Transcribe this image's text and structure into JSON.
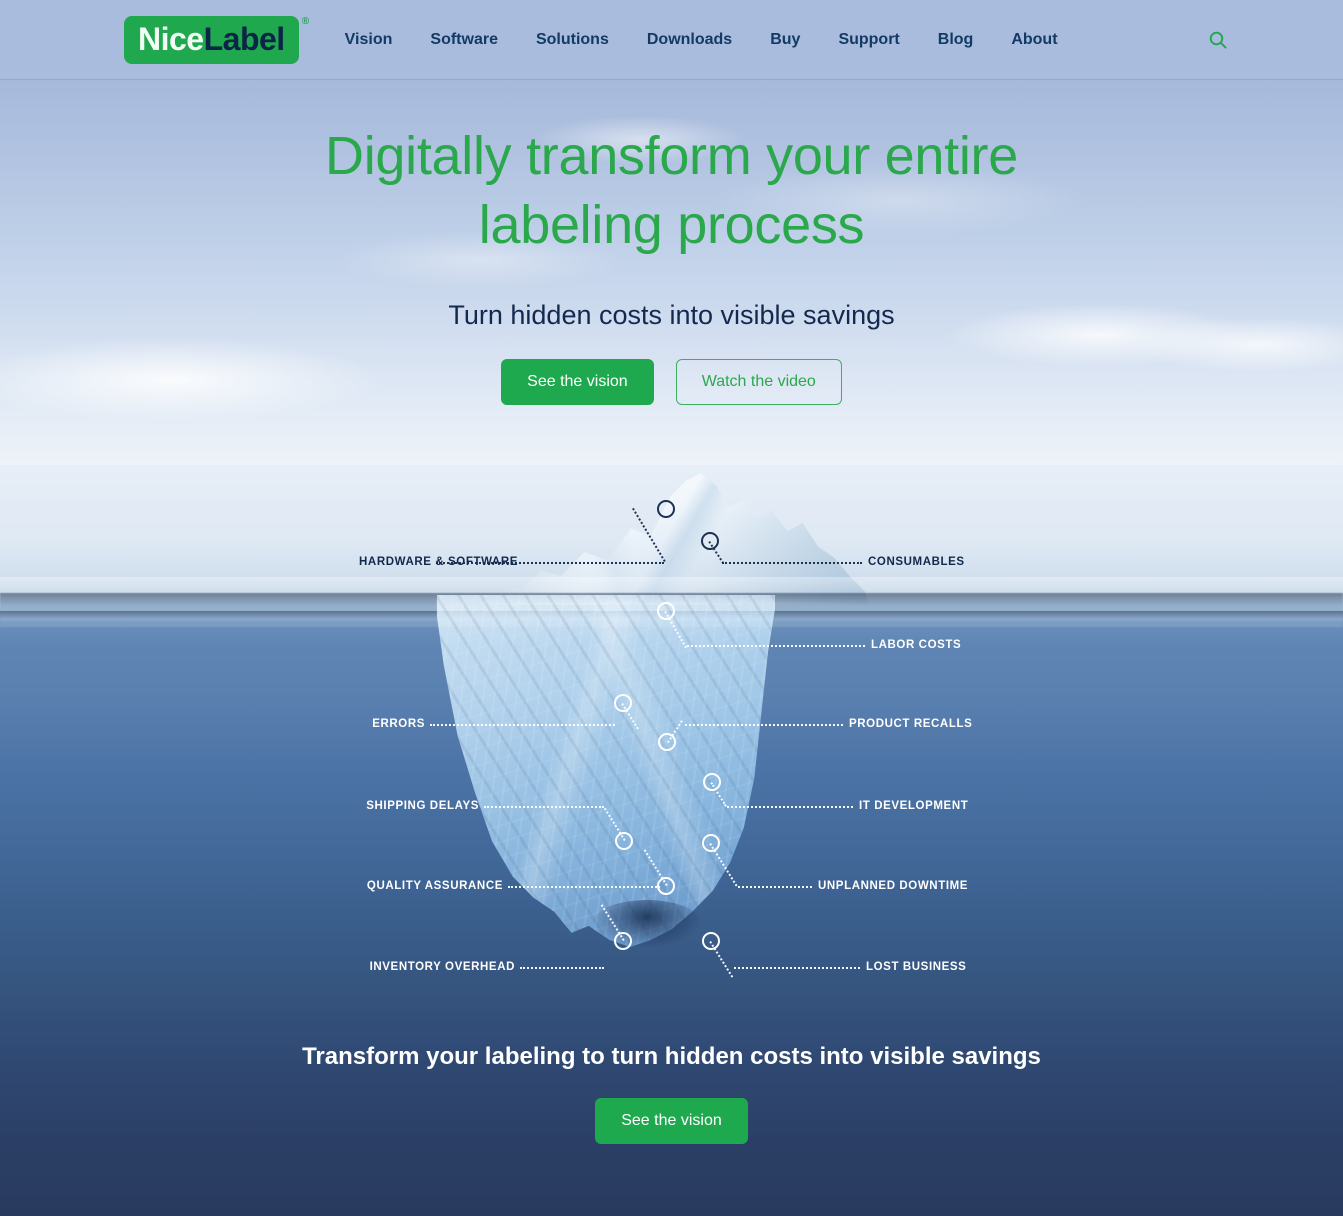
{
  "header": {
    "logo": {
      "part1": "Nice",
      "part2": "Label",
      "trademark": "®"
    },
    "nav": [
      {
        "label": "Vision"
      },
      {
        "label": "Software"
      },
      {
        "label": "Solutions"
      },
      {
        "label": "Downloads"
      },
      {
        "label": "Buy"
      },
      {
        "label": "Support"
      },
      {
        "label": "Blog"
      },
      {
        "label": "About"
      }
    ],
    "search_icon": "search-icon"
  },
  "hero": {
    "headline_line1": "Digitally transform your entire",
    "headline_line2": "labeling process",
    "subheadline": "Turn hidden costs into visible savings",
    "primary_button": "See the vision",
    "secondary_button": "Watch the video"
  },
  "iceberg": {
    "labels_above_water": [
      {
        "text": "HARDWARE & SOFTWARE",
        "side": "left"
      },
      {
        "text": "CONSUMABLES",
        "side": "right"
      }
    ],
    "labels_below_water": [
      {
        "text": "LABOR COSTS",
        "side": "right"
      },
      {
        "text": "ERRORS",
        "side": "left"
      },
      {
        "text": "PRODUCT RECALLS",
        "side": "right"
      },
      {
        "text": "SHIPPING DELAYS",
        "side": "left"
      },
      {
        "text": "IT DEVELOPMENT",
        "side": "right"
      },
      {
        "text": "QUALITY ASSURANCE",
        "side": "left"
      },
      {
        "text": "UNPLANNED DOWNTIME",
        "side": "right"
      },
      {
        "text": "INVENTORY OVERHEAD",
        "side": "left"
      },
      {
        "text": "LOST BUSINESS",
        "side": "right"
      }
    ]
  },
  "bottom_cta": {
    "heading": "Transform your labeling to turn hidden costs into visible savings",
    "button": "See the vision"
  },
  "colors": {
    "brand_green": "#1fa94e",
    "headline_green": "#2aa84b",
    "navy": "#12294b",
    "header_bg": "#a9bcdd",
    "deep_water": "#293a5e"
  }
}
